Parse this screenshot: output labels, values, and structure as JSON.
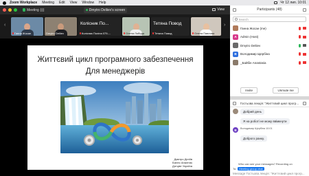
{
  "menubar": {
    "app_name": "Zoom Workplace",
    "items": [
      "Meeting",
      "Edit",
      "View",
      "Window",
      "Help"
    ],
    "clock": "Чт 12 лип. 10:01"
  },
  "window": {
    "tab_label": "Meeting",
    "share_label": "Dmytro Deliiev's screen",
    "view_label": "View"
  },
  "strip": {
    "tiles": [
      {
        "name": "Ганна Жосан",
        "muted": true
      },
      {
        "name": "Dmytro Deliiev",
        "muted": false
      },
      {
        "big_name": "Колісник По...",
        "name": "Колісник Поліна 079-...",
        "muted": true
      },
      {
        "name": "Олена Лобода",
        "muted": true
      },
      {
        "big_name": "Тетяна Повод",
        "name": "Тетяна Повод",
        "muted": true
      },
      {
        "name": "Олена Павлова",
        "muted": true
      }
    ]
  },
  "slide": {
    "title_line1": "Життєвий цикл програмного забезпечення",
    "title_line2": "Для менеджерів",
    "author_line1": "Дмитро Деліїв",
    "author_line2": "Бізнес Аналітик",
    "author_line3": "Дотцівт Україна"
  },
  "participants": {
    "title": "Participants (48)",
    "search_placeholder": "Search",
    "rows": [
      {
        "initial": "",
        "name": "Ганна Жосан (me)",
        "color": "#b07a5a",
        "mic": "muted",
        "cam": "off"
      },
      {
        "initial": "A",
        "name": "Admin (Host)",
        "color": "#d7398a",
        "mic": "muted",
        "cam": "off"
      },
      {
        "initial": "",
        "name": "Dmytro Deliiev",
        "color": "#6a6a6a",
        "mic": "on",
        "cam": "on"
      },
      {
        "initial": "В",
        "name": "Володимир Щербіна",
        "color": "#2f6fde",
        "mic": "muted",
        "cam": "off"
      },
      {
        "initial": "",
        "name": "_Байбін Anastasia",
        "color": "#8a7a6a",
        "mic": "muted",
        "cam": "off"
      }
    ],
    "invite_label": "Invite",
    "unmute_label": "Unmute me"
  },
  "chat": {
    "title": "Гостьова лекція: \"Життєвий цикл прогр...",
    "messages": [
      {
        "text": "Добрий день",
        "avatar": "",
        "color": "#9b8a7a",
        "meta": ""
      },
      {
        "text": "Я на роботі не можу ввімкнути",
        "avatar": "",
        "color": "#ffffff",
        "meta": ""
      },
      {
        "text": "Доброго ранку.",
        "avatar": "В",
        "color": "#6d3fc2",
        "meta": "Володимир Щербіна  10:01"
      }
    ],
    "recording_note": "Who can see your messages? Recording on",
    "to_label": "To:",
    "to_value": "Meeting group chat",
    "input_placeholder": "Message Гостьова лекція: \"Життєвий цикл прогр..."
  },
  "colors": {
    "accent": "#0e72ed",
    "muted_red": "#e33333",
    "mac_red": "#ff5f57",
    "mac_yellow": "#febc2e",
    "mac_green": "#28c840"
  }
}
